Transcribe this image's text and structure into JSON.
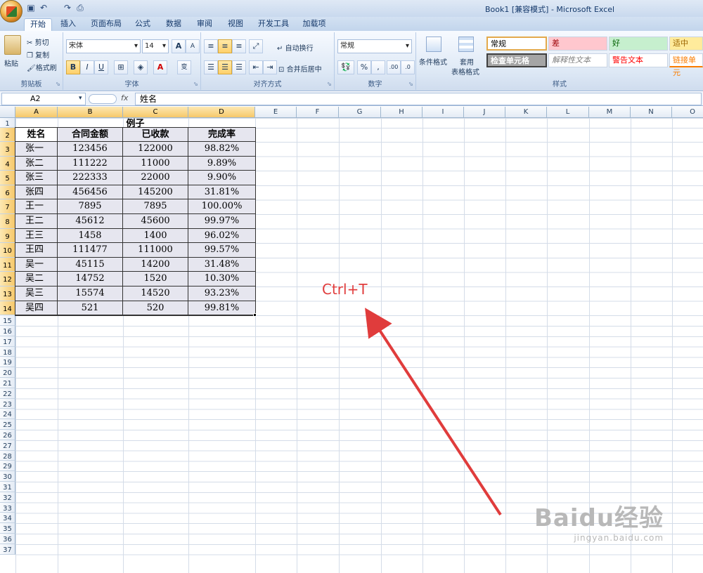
{
  "window": {
    "title": "Book1  [兼容模式] - Microsoft Excel"
  },
  "tabs": [
    "开始",
    "插入",
    "页面布局",
    "公式",
    "数据",
    "审阅",
    "视图",
    "开发工具",
    "加载项"
  ],
  "ribbon": {
    "clipboard": {
      "label": "剪贴板",
      "paste": "粘贴",
      "cut": "剪切",
      "copy": "复制",
      "format_painter": "格式刷"
    },
    "font": {
      "label": "字体",
      "name": "宋体",
      "size": "14",
      "bold": "B",
      "italic": "I",
      "underline": "U",
      "grow": "A",
      "shrink": "A",
      "phonetic": "变"
    },
    "alignment": {
      "label": "对齐方式",
      "wrap_text": "自动换行",
      "merge_center": "合并后居中"
    },
    "number": {
      "label": "数字",
      "format": "常规",
      "percent": "%",
      "comma": ",",
      "inc_decimal": ".00",
      "dec_decimal": ".0"
    },
    "styles": {
      "label": "样式",
      "conditional": "条件格式",
      "table_format_1": "套用",
      "table_format_2": "表格格式",
      "cells": [
        {
          "text": "常规",
          "bg": "#ffffff",
          "color": "#000000"
        },
        {
          "text": "差",
          "bg": "#ffc7ce",
          "color": "#9c0006"
        },
        {
          "text": "好",
          "bg": "#c6efce",
          "color": "#006100"
        },
        {
          "text": "适中",
          "bg": "#ffeb9c",
          "color": "#9c6500"
        },
        {
          "text": "检查单元格",
          "bg": "#a5a5a5",
          "color": "#ffffff"
        },
        {
          "text": "解释性文本",
          "bg": "#ffffff",
          "color": "#7f7f7f"
        },
        {
          "text": "警告文本",
          "bg": "#ffffff",
          "color": "#ff0000"
        },
        {
          "text": "链接单元",
          "bg": "#ffffff",
          "color": "#fa7d00"
        }
      ]
    }
  },
  "formula_bar": {
    "name_box": "A2",
    "fx": "fx",
    "content": "姓名"
  },
  "columns": [
    "A",
    "B",
    "C",
    "D",
    "E",
    "F",
    "G",
    "H",
    "I",
    "J",
    "K",
    "L",
    "M",
    "N",
    "O"
  ],
  "rows": [
    "1",
    "2",
    "3",
    "4",
    "5",
    "6",
    "7",
    "8",
    "9",
    "10",
    "11",
    "12",
    "13",
    "14",
    "15",
    "16",
    "17",
    "18",
    "19",
    "20",
    "21",
    "22",
    "23",
    "24",
    "25",
    "26",
    "27",
    "28",
    "29",
    "30",
    "31",
    "32",
    "33",
    "34",
    "35",
    "36",
    "37"
  ],
  "sheet": {
    "title": "例子",
    "headers": [
      "姓名",
      "合同金额",
      "已收款",
      "完成率"
    ],
    "rows": [
      [
        "张一",
        "123456",
        "122000",
        "98.82%"
      ],
      [
        "张二",
        "111222",
        "11000",
        "9.89%"
      ],
      [
        "张三",
        "222333",
        "22000",
        "9.90%"
      ],
      [
        "张四",
        "456456",
        "145200",
        "31.81%"
      ],
      [
        "王一",
        "7895",
        "7895",
        "100.00%"
      ],
      [
        "王二",
        "45612",
        "45600",
        "99.97%"
      ],
      [
        "王三",
        "1458",
        "1400",
        "96.02%"
      ],
      [
        "王四",
        "111477",
        "111000",
        "99.57%"
      ],
      [
        "吴一",
        "45115",
        "14200",
        "31.48%"
      ],
      [
        "吴二",
        "14752",
        "1520",
        "10.30%"
      ],
      [
        "吴三",
        "15574",
        "14520",
        "93.23%"
      ],
      [
        "吴四",
        "521",
        "520",
        "99.81%"
      ]
    ]
  },
  "annotation": {
    "text": "Ctrl+T",
    "color": "#e03c3c"
  },
  "watermark": {
    "brand": "Baidu经验",
    "url": "jingyan.baidu.com"
  }
}
